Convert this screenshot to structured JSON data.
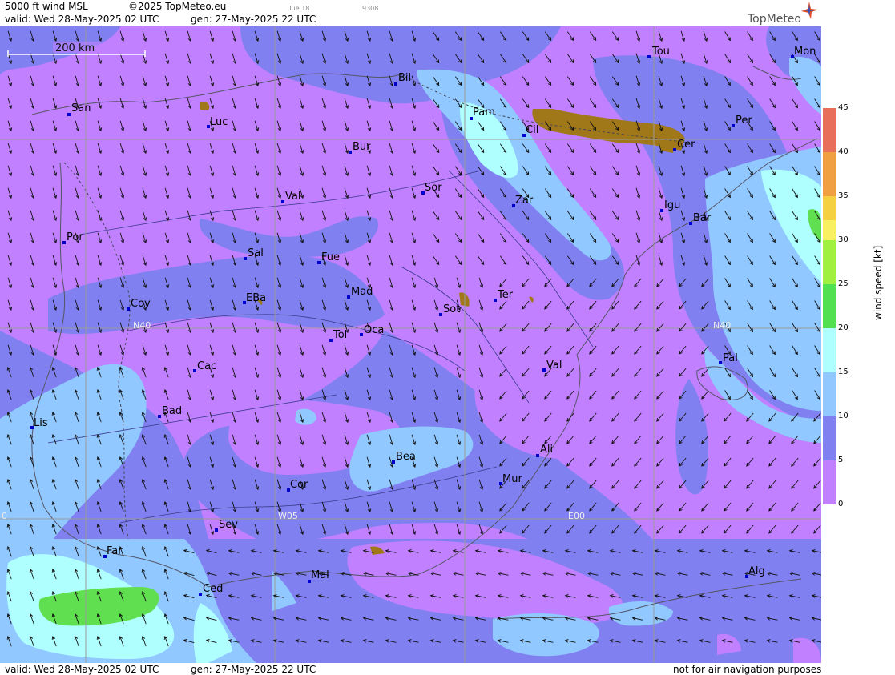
{
  "header": {
    "product": "5000 ft wind MSL",
    "copyright": "©2025 TopMeteo.eu",
    "small_date": "Tue 18",
    "small_code": "9308",
    "valid": "valid:  Wed  28-May-2025  02 UTC",
    "gen": "gen: 27-May-2025 22 UTC",
    "logo": "TopMeteo"
  },
  "footer": {
    "valid": "valid:  Wed  28-May-2025  02 UTC",
    "gen": "gen: 27-May-2025 22 UTC",
    "note": "not for air navigation purposes"
  },
  "scale_bar": "200 km",
  "legend": {
    "title": "wind speed  [kt]",
    "ticks": [
      "45",
      "40",
      "35",
      "30",
      "25",
      "20",
      "15",
      "10",
      "5",
      "0"
    ],
    "colors": [
      "#e8705a",
      "#f0a040",
      "#f5d040",
      "#f8f060",
      "#a0f040",
      "#50e050",
      "#b0ffff",
      "#90c8ff",
      "#8080f0",
      "#c080ff"
    ]
  },
  "grid_labels": [
    "N40",
    "N40",
    "W05",
    "E00",
    "0"
  ],
  "cities": [
    "San",
    "Luc",
    "Bil",
    "Tou",
    "Mon",
    "Pam",
    "Cil",
    "Bur",
    "Per",
    "Cer",
    "Val",
    "Sor",
    "Zar",
    "Igu",
    "Bar",
    "Por",
    "Sal",
    "Fue",
    "Cov",
    "EBa",
    "Mad",
    "Sot",
    "Ter",
    "Tol",
    "Oca",
    "Cac",
    "Val",
    "Pal",
    "Bad",
    "Lis",
    "Bea",
    "Ali",
    "Cor",
    "Mur",
    "Sev",
    "Far",
    "Mal",
    "Alg",
    "Ced"
  ],
  "colors": {
    "low": "#c080ff",
    "mid": "#8080f0",
    "blue": "#90c8ff",
    "cyan": "#b0ffff",
    "green": "#60e050",
    "terrain": "#a0781a"
  }
}
